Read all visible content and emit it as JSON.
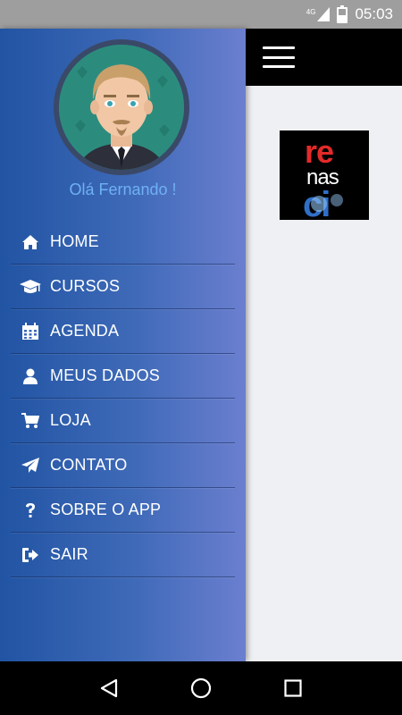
{
  "status_bar": {
    "network": "4G",
    "time": "05:03"
  },
  "drawer": {
    "greeting": "Olá Fernando !",
    "items": [
      {
        "label": "HOME",
        "icon": "home-icon"
      },
      {
        "label": "CURSOS",
        "icon": "graduation-cap-icon"
      },
      {
        "label": "AGENDA",
        "icon": "calendar-icon"
      },
      {
        "label": "MEUS DADOS",
        "icon": "user-icon"
      },
      {
        "label": "LOJA",
        "icon": "cart-icon"
      },
      {
        "label": "CONTATO",
        "icon": "paper-plane-icon"
      },
      {
        "label": "SOBRE O APP",
        "icon": "question-icon"
      },
      {
        "label": "SAIR",
        "icon": "sign-out-icon"
      }
    ]
  },
  "main": {
    "logo_lines": [
      "re",
      "nas",
      "ci"
    ]
  },
  "colors": {
    "drawer_start": "#2154a3",
    "drawer_end": "#6b7fcf",
    "greeting": "#6fb1f2",
    "logo_red": "#e32a2a",
    "logo_blue": "#2f6fc8"
  }
}
